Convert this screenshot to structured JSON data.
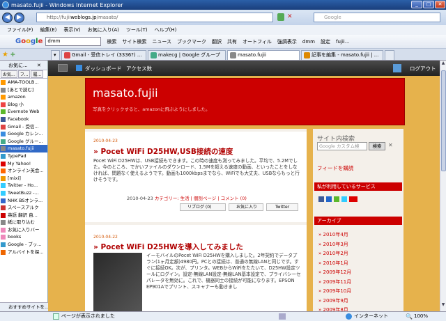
{
  "window": {
    "title": "masato.fujii - Windows Internet Explorer"
  },
  "address": {
    "prefix": "http://fujii",
    "bold": "weblogs.jp",
    "suffix": "/masato/"
  },
  "search": {
    "placeholder": "Google"
  },
  "menu": [
    "ファイル(F)",
    "編集(E)",
    "表示(V)",
    "お気に入り(A)",
    "ツール(T)",
    "ヘルプ(H)"
  ],
  "google_bar": {
    "query": "dmm",
    "items": [
      "検索",
      "サイト検索",
      "ニュース",
      "ブックマーク",
      "翻訳",
      "共有",
      "オートフィル",
      "強調表示",
      "dmm",
      "設定",
      "fujii..."
    ]
  },
  "tabs": [
    {
      "label": "Gmail - 受信トレイ (3336?) ...",
      "color": "#d44"
    },
    {
      "label": "makecg | Google グループ",
      "color": "#4a8"
    },
    {
      "label": "masato.fujii",
      "color": "#888",
      "active": true
    },
    {
      "label": "記事を編集 - masato.fujii | ...",
      "color": "#d80"
    }
  ],
  "favorites": {
    "header": "お気に...",
    "tabs": [
      "お気...",
      "フ...",
      "履..."
    ],
    "items": [
      "AMA-TOOLB...",
      "[あとで読む]",
      "amazon",
      "Blog 小",
      "Evernote Web",
      "Facebook",
      "Gmail - 受信...",
      "Google カレン...",
      "Google グルー...",
      "masato.fujii",
      "TypePad",
      "My Yahoo!",
      "オンライン英会...",
      "[mixi]",
      "Twitter - Ho...",
      "TweetBuzz -...",
      "NHK BSオンラ...",
      "スペースアルク",
      "英語 翻訳 自...",
      "紙に取り込む",
      "お気に入りバー",
      "books",
      "Google - ブッ...",
      "アルバイトを探..."
    ],
    "selected": 9,
    "bottom": "おすすめサイトを..."
  },
  "blog_nav": {
    "dashboard": "ダッシュボード",
    "access": "アクセス数",
    "logout": "ログアウト"
  },
  "blog": {
    "title": "masato.fujii",
    "subtitle": "写真をクリックすると、amazonに飛ぶようにしました。"
  },
  "posts": [
    {
      "date": "2010-04-23",
      "title": "Pocet WiFi D25HW,USB接続の速度",
      "body": "Pocet WiFi D25HWは、USB接続もできます。この時の速度も測ってみました。平均で、5.2Mでした。今のところ、でかいファイルのダウンロード、1.5Mを超える速度の動画、といったことをしなければ、問題なく使えるようです。動画も1000kbpsまでなら、WiFiでも大丈夫、USBならもっと行けそうです。",
      "meta_date": "2010-04-23",
      "meta_rest": " カテゴリー: 生活 | 個別ページ | コメント (0)",
      "reblog": "リブログ (0)",
      "fav": "お気に入り",
      "twitter": "Twitter"
    },
    {
      "date": "2010-04-22",
      "title": "Pocet WiFi D25HWを導入してみました",
      "body": "イーモバイルのPocet WiFi D25HWを購入しました。2年契約でデータプラン(1ヶ月定額)4980円。PCとの接続は、普通の無線LANと同じです。すぐに接続OK。次が、プリンタ。WEBからWiFiをたたいて、D25HW設定ツールにログイン。設定-無線LAN設定-無線LAN基本設定で、プライバシーセパレータを無効に。これで、機器同士の接続が可能になります。EPSON EP901Aでプリント、スキャナーも動きまし"
    }
  ],
  "sidebar": {
    "search_title": "サイト内検索",
    "search_placeholder": "Google カスタム検",
    "search_button": "検索",
    "feed": "フィードを購読",
    "using_title": "私が利用しているサービス",
    "archive_title": "アーカイブ",
    "archives": [
      "2010年4月",
      "2010年3月",
      "2010年2月",
      "2010年1月",
      "2009年12月",
      "2009年11月",
      "2009年10月",
      "2009年9月",
      "2009年8月"
    ]
  },
  "status": {
    "text": "ページが表示されました",
    "zone": "インターネット",
    "zoom": "100%"
  }
}
